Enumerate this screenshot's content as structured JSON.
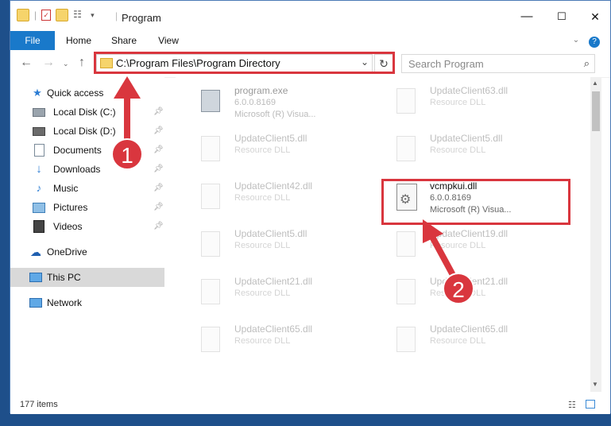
{
  "window": {
    "title": "Program",
    "controls": {
      "minimize": "—",
      "maximize": "☐",
      "close": "✕"
    }
  },
  "ribbon": {
    "tabs": [
      "File",
      "Home",
      "Share",
      "View"
    ],
    "help": "?"
  },
  "address": {
    "path": "C:\\Program Files\\Program Directory",
    "search_placeholder": "Search Program"
  },
  "sidebar": {
    "quick_access": "Quick access",
    "items": [
      {
        "label": "Local Disk (C:)",
        "icon": "drive-icon"
      },
      {
        "label": "Local Disk (D:)",
        "icon": "drive-icon"
      },
      {
        "label": "Documents",
        "icon": "documents-icon"
      },
      {
        "label": "Downloads",
        "icon": "downloads-icon"
      },
      {
        "label": "Music",
        "icon": "music-icon"
      },
      {
        "label": "Pictures",
        "icon": "pictures-icon"
      },
      {
        "label": "Videos",
        "icon": "videos-icon"
      }
    ],
    "onedrive": "OneDrive",
    "this_pc": "This PC",
    "network": "Network"
  },
  "files": [
    {
      "name": "program.exe",
      "line2": "6.0.0.8169",
      "line3": "Microsoft (R) Visua..."
    },
    {
      "name": "UpdateClient63.dll",
      "line2": "Resource DLL",
      "line3": ""
    },
    {
      "name": "UpdateClient5.dll",
      "line2": "Resource DLL",
      "line3": ""
    },
    {
      "name": "UpdateClient5.dll",
      "line2": "Resource DLL",
      "line3": ""
    },
    {
      "name": "UpdateClient42.dll",
      "line2": "Resource DLL",
      "line3": ""
    },
    {
      "name": "vcmpkui.dll",
      "line2": "6.0.0.8169",
      "line3": "Microsoft (R) Visua..."
    },
    {
      "name": "UpdateClient5.dll",
      "line2": "Resource DLL",
      "line3": ""
    },
    {
      "name": "UpdateClient19.dll",
      "line2": "Resource DLL",
      "line3": ""
    },
    {
      "name": "UpdateClient21.dll",
      "line2": "Resource DLL",
      "line3": ""
    },
    {
      "name": "UpdateClient21.dll",
      "line2": "Resource DLL",
      "line3": ""
    },
    {
      "name": "UpdateClient65.dll",
      "line2": "Resource DLL",
      "line3": ""
    },
    {
      "name": "UpdateClient65.dll",
      "line2": "Resource DLL",
      "line3": ""
    }
  ],
  "status": {
    "count": "177 items"
  },
  "callouts": [
    "1",
    "2"
  ],
  "colors": {
    "accent": "#1979ca",
    "highlight_red": "#d9363e"
  }
}
